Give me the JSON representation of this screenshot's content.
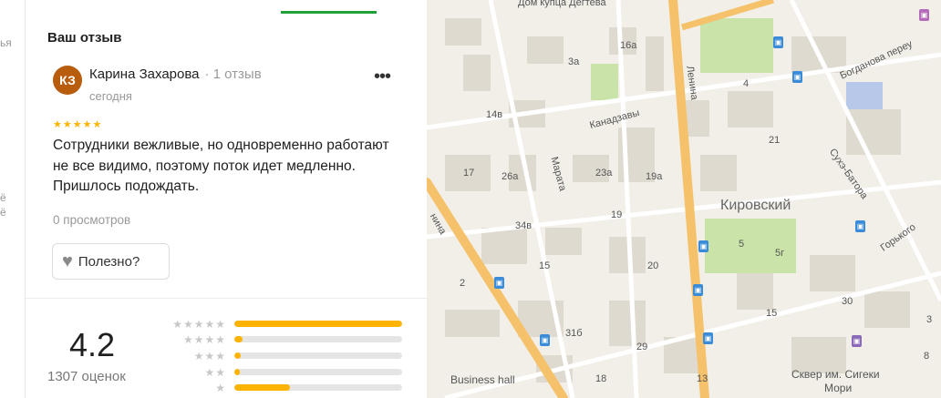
{
  "left_strip": {
    "fragments": [
      "ья",
      "ё",
      "ё"
    ]
  },
  "review_section": {
    "title": "Ваш отзыв"
  },
  "review": {
    "avatar_initials": "КЗ",
    "author": "Карина Захарова",
    "author_review_count": "· 1 отзыв",
    "date": "сегодня",
    "more_label": "•••",
    "rating_stars": 5,
    "stars_glyphs": "★★★★★",
    "text": "Сотрудники вежливые, но одновременно работают не все видимо, поэтому поток идет медленно. Пришлось подождать.",
    "views": "0 просмотров",
    "useful_label": "Полезно?"
  },
  "rating_summary": {
    "value": "4.2",
    "count_label": "1307 оценок",
    "distribution": [
      {
        "stars": 5,
        "glyphs": "★★★★★",
        "fraction": 1.0
      },
      {
        "stars": 4,
        "glyphs": "★★★★",
        "fraction": 0.05
      },
      {
        "stars": 3,
        "glyphs": "★★★",
        "fraction": 0.04
      },
      {
        "stars": 2,
        "glyphs": "★★",
        "fraction": 0.03
      },
      {
        "stars": 1,
        "glyphs": "★",
        "fraction": 0.33
      }
    ]
  },
  "map": {
    "labels": {
      "dom_kupca": "Дом купца Дегтева",
      "bogdanova": "Богданова переу",
      "lenina": "Ленина",
      "kanadzavy": "Канадзавы",
      "marata": "Марата",
      "kirovsky": "Кировский",
      "suhe_batora": "Сухэ-Батора",
      "gorkogo": "Горького",
      "lenina_left": "нина",
      "business_hall": "Business hall",
      "skver_line1": "Сквер им. Сигеки",
      "skver_line2": "Мори"
    },
    "house_numbers": {
      "n16a": "16а",
      "n3a": "3а",
      "n4": "4",
      "n14v": "14в",
      "n21": "21",
      "n17": "17",
      "n26a": "26а",
      "n23a": "23а",
      "n19a": "19а",
      "n19": "19",
      "n34v": "34в",
      "n15": "15",
      "n20": "20",
      "n5": "5",
      "n5g": "5г",
      "n30": "30",
      "n15b": "15",
      "n31b": "31б",
      "n29": "29",
      "n3": "3",
      "n8": "8",
      "n13": "13",
      "n18": "18",
      "n2": "2"
    },
    "colors": {
      "base": "#f1efe8",
      "main_road": "#f5c26b",
      "road": "#ffffff",
      "park": "#c9e3a8",
      "water_like": "#b7c8e8"
    }
  }
}
